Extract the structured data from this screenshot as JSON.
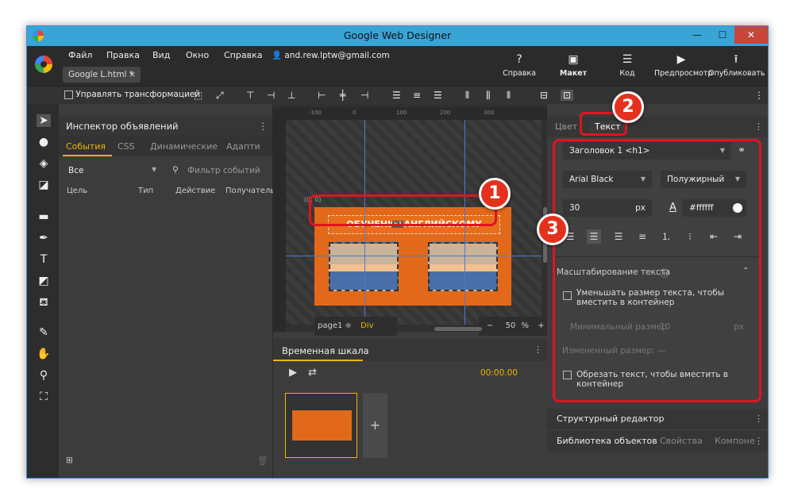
{
  "title": "Google Web Designer",
  "window_buttons": {
    "minimize": "—",
    "maximize": "☐",
    "close": "✕"
  },
  "menu": [
    "Файл",
    "Правка",
    "Вид",
    "Окно",
    "Справка"
  ],
  "user_email": "and.rew.lptw@gmail.com",
  "doc_tab": {
    "label": "Google L.html *",
    "close": "×"
  },
  "top_buttons": [
    {
      "label": "Справка",
      "icon": "?"
    },
    {
      "label": "Макет",
      "icon": "▣"
    },
    {
      "label": "Код",
      "icon": "☰"
    },
    {
      "label": "Предпросмотр",
      "icon": "▶"
    },
    {
      "label": "Опубликовать",
      "icon": "⭱"
    }
  ],
  "toolbar": {
    "transform_label": "Управлять трансформацией"
  },
  "inspector": {
    "title": "Инспектор объявлений",
    "tabs": [
      "События",
      "CSS",
      "Динамические",
      "Адапти"
    ],
    "filter_select": "Все",
    "filter_placeholder": "Фильтр событий",
    "columns": [
      "Цель",
      "Тип",
      "Действие",
      "Получатель"
    ]
  },
  "canvas": {
    "origin_label": "(0, 0)",
    "banner_text": "ОБУЧЕНИЕ АНГЛИЙСКОМУ",
    "element_tag": "h3",
    "page_label": "page1 ≑",
    "div_label": "Div",
    "zoom_minus": "−",
    "zoom_value": "50",
    "zoom_unit": "%",
    "zoom_plus": "+",
    "ruler_marks": [
      "-100",
      "0",
      "100",
      "200",
      "300"
    ]
  },
  "timeline": {
    "title": "Временная шкала",
    "time": "00:00.00",
    "add_label": "+"
  },
  "right_panel": {
    "tabs": [
      "Цвет",
      "Текст"
    ],
    "heading_select": "Заголовок 1 <h1>",
    "font": "Arial Black",
    "weight": "Полужирный",
    "size": "30",
    "size_unit": "px",
    "color_letter": "A",
    "color": "#ffffff",
    "scaling_title": "Масштабирование текста",
    "shrink_label": "Уменьшать размер текста, чтобы вместить в контейнер",
    "min_size_label": "Минимальный размер",
    "min_size_value": "10",
    "min_size_unit": "px",
    "changed_size": "Измененный размер: —",
    "crop_label": "Обрезать текст, чтобы вместить в контейнер",
    "structure_editor": "Структурный редактор",
    "bottom_tabs": [
      "Библиотека объектов",
      "Свойства",
      "Компоне"
    ]
  },
  "annotations": [
    "1",
    "2",
    "3"
  ],
  "colors": {
    "accent": "#f0b400",
    "annotation_red": "#e0141e",
    "titlebar": "#39a4d6",
    "banner_orange": "#e2691a"
  }
}
